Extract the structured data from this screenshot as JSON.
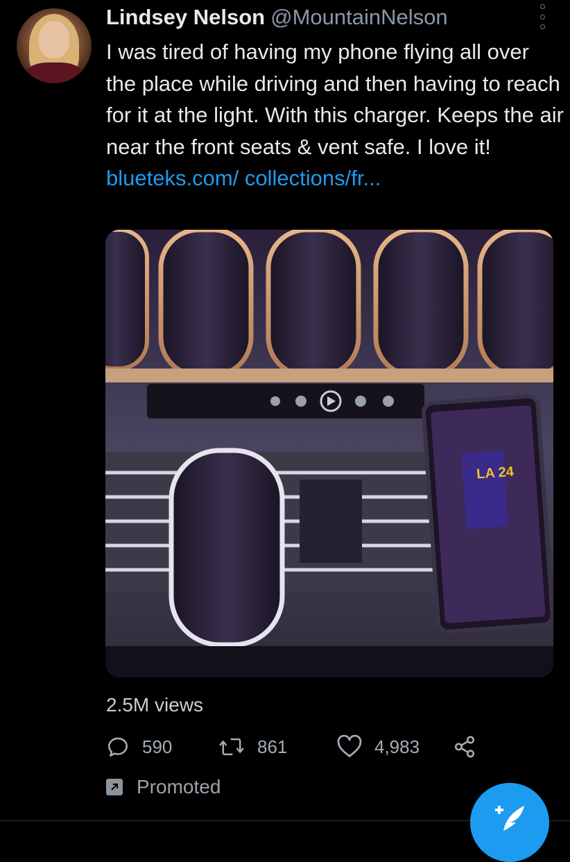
{
  "tweet": {
    "author_name": "Lindsey Nelson",
    "author_handle": "@MountainNelson",
    "text": "I was tired of having my phone flying all over the place while driving and then having to reach for it at the light. With this charger. Keeps the air near the front seats & vent safe. I love it! ",
    "link_text": "blueteks.com/ collections/fr...",
    "views": "2.5M views",
    "replies": "590",
    "retweets": "861",
    "likes": "4,983",
    "promoted_label": "Promoted",
    "media_label": "LA 24"
  },
  "icons": {
    "avatar": "avatar",
    "more": "more-vertical-icon",
    "reply": "reply-icon",
    "retweet": "retweet-icon",
    "like": "heart-icon",
    "share": "share-icon",
    "promoted": "promoted-arrow-icon",
    "compose": "compose-tweet-icon"
  },
  "colors": {
    "background": "#000000",
    "text": "#e7e9ea",
    "secondary": "#8b98a5",
    "link": "#1d9bf0",
    "fab": "#1d9bf0"
  }
}
